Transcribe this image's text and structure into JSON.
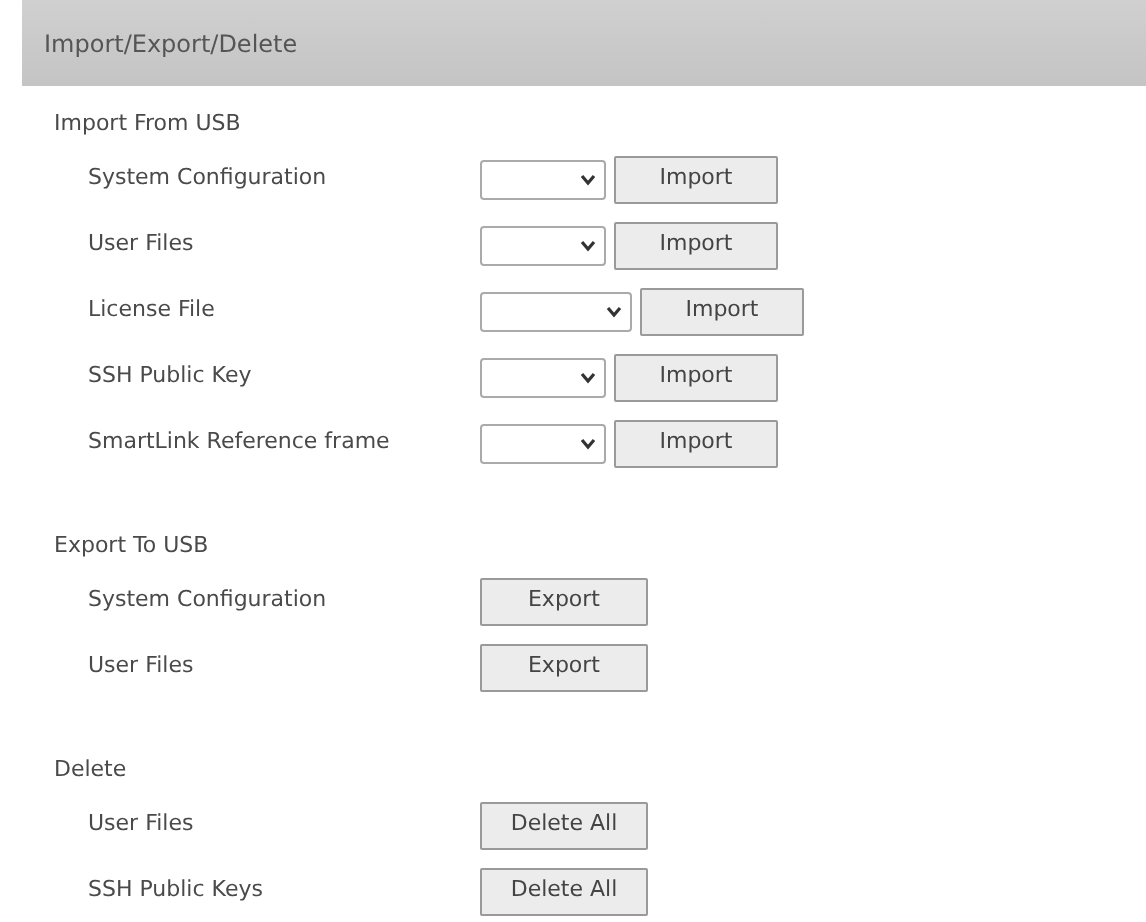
{
  "panel": {
    "title": "Import/Export/Delete"
  },
  "sections": [
    {
      "title": "Import From USB",
      "rows": [
        {
          "label": "System Configuration",
          "kind": "import",
          "button": "Import"
        },
        {
          "label": "User Files",
          "kind": "import",
          "button": "Import"
        },
        {
          "label": "License File",
          "kind": "import",
          "button": "Import"
        },
        {
          "label": "SSH Public Key",
          "kind": "import",
          "button": "Import"
        },
        {
          "label": "SmartLink Reference frame",
          "kind": "import",
          "button": "Import"
        }
      ]
    },
    {
      "title": "Export To USB",
      "rows": [
        {
          "label": "System Configuration",
          "kind": "action",
          "button": "Export"
        },
        {
          "label": "User Files",
          "kind": "action",
          "button": "Export"
        }
      ]
    },
    {
      "title": "Delete",
      "rows": [
        {
          "label": "User Files",
          "kind": "action",
          "button": "Delete All"
        },
        {
          "label": "SSH Public Keys",
          "kind": "action",
          "button": "Delete All"
        }
      ]
    }
  ]
}
